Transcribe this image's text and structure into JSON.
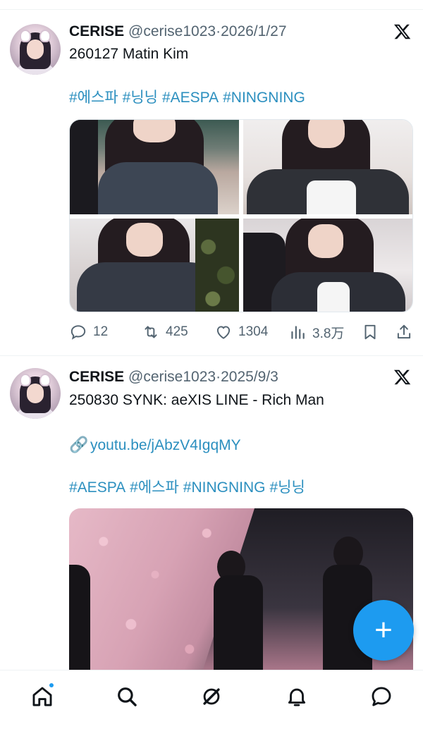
{
  "colors": {
    "accent": "#1d9bf0",
    "hashtag": "#2b8fbf",
    "muted": "#536471",
    "text": "#0f1419"
  },
  "tweets": [
    {
      "author": {
        "name": "CERISE",
        "handle": "@cerise1023"
      },
      "separator": "·",
      "date": "2026/1/27",
      "text": "260127 Matin Kim",
      "hashtags": [
        "#에스파",
        "#닝닝",
        "#AESPA",
        "#NINGNING"
      ],
      "media": {
        "type": "photo-grid",
        "count": 4
      },
      "stats": {
        "replies": "12",
        "retweets": "425",
        "likes": "1304",
        "views": "3.8万"
      }
    },
    {
      "author": {
        "name": "CERISE",
        "handle": "@cerise1023"
      },
      "separator": "·",
      "date": "2025/9/3",
      "text": "250830 SYNK: aeXIS LINE - Rich Man",
      "link": "youtu.be/jAbzV4IgqMY",
      "hashtags": [
        "#AESPA",
        "#에스파",
        "#NINGNING",
        "#닝닝"
      ],
      "media": {
        "type": "video"
      }
    }
  ],
  "icons": {
    "platform": "x-logo-icon",
    "reply": "reply-icon",
    "retweet": "retweet-icon",
    "like": "heart-icon",
    "views": "views-icon",
    "bookmark": "bookmark-icon",
    "share": "share-icon",
    "link": "link-icon",
    "compose": "plus-icon"
  },
  "fab": {
    "label": "+"
  },
  "tabbar": {
    "tabs": [
      "home",
      "search",
      "grok",
      "notifications",
      "messages"
    ],
    "home_has_notification_dot": true
  }
}
